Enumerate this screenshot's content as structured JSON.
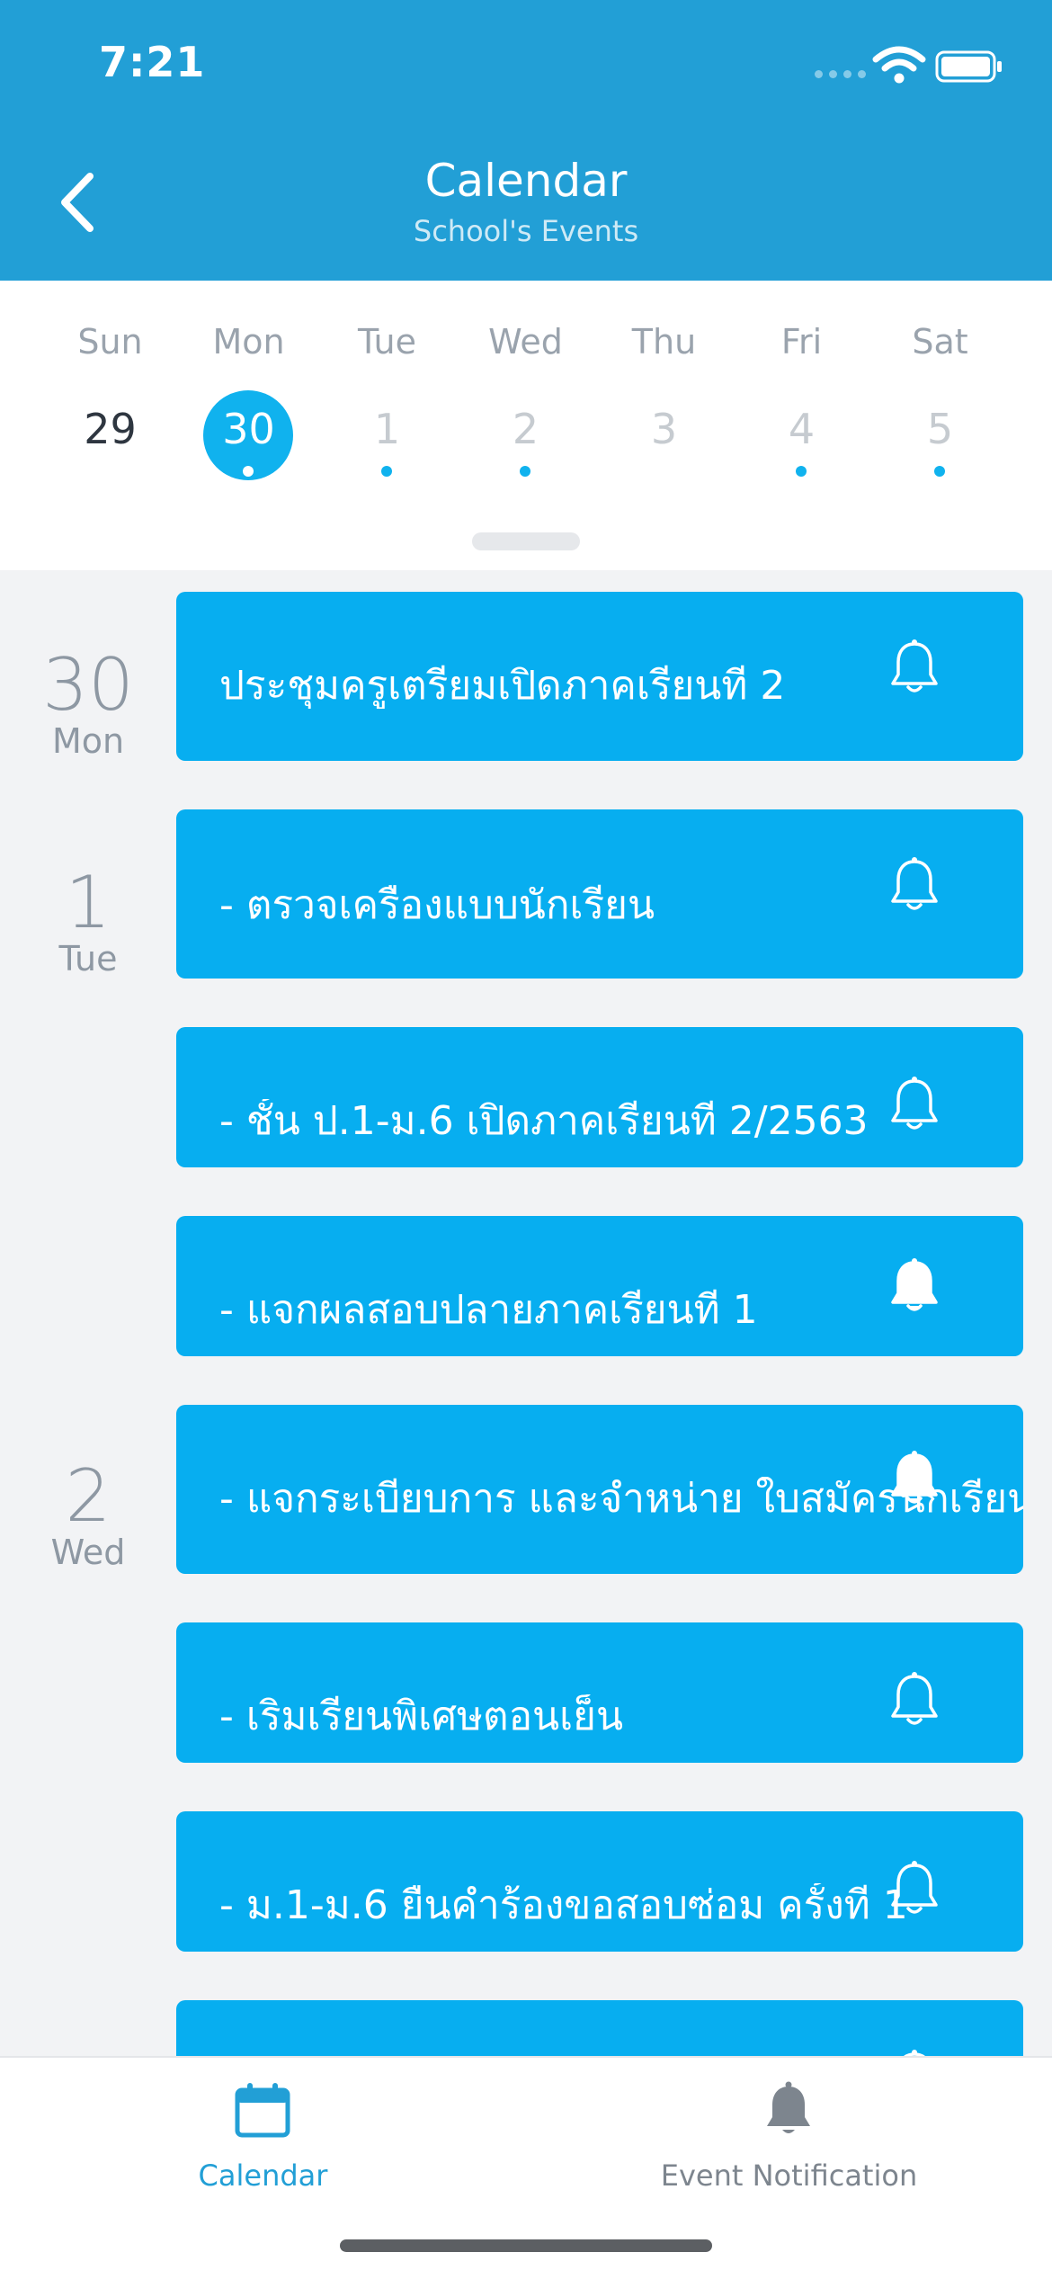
{
  "status_bar": {
    "time": "7:21"
  },
  "header": {
    "title": "Calendar",
    "subtitle": "School's Events"
  },
  "week": [
    {
      "weekday": "Sun",
      "day": "29"
    },
    {
      "weekday": "Mon",
      "day": "30"
    },
    {
      "weekday": "Tue",
      "day": "1"
    },
    {
      "weekday": "Wed",
      "day": "2"
    },
    {
      "weekday": "Thu",
      "day": "3"
    },
    {
      "weekday": "Fri",
      "day": "4"
    },
    {
      "weekday": "Sat",
      "day": "5"
    }
  ],
  "date_groups": [
    {
      "day": "30",
      "weekday": "Mon"
    },
    {
      "day": "1",
      "weekday": "Tue"
    },
    {
      "day": "2",
      "weekday": "Wed"
    }
  ],
  "events": [
    {
      "title": "ประชุมครูเตรียมเปิดภาคเรียนที่ 2"
    },
    {
      "title": "- ตรวจเครื่องแบบนักเรียน"
    },
    {
      "title": "- ชั้น ป.1-ม.6 เปิดภาคเรียนที่ 2/2563"
    },
    {
      "title": "- แจกผลสอบปลายภาคเรียนที่ 1"
    },
    {
      "title": "- แจกระเบียบการ และจำหน่าย ใบสมัครนักเรียน"
    },
    {
      "title": "- เริ่มเรียนพิเศษตอนเย็น"
    },
    {
      "title": "- ม.1-ม.6 ยื่นคำร้องขอสอบซ่อม ครั้งที่ 1"
    }
  ],
  "tabs": [
    {
      "label": "Calendar"
    },
    {
      "label": "Event Notification"
    }
  ],
  "colors": {
    "header": "#229fd6",
    "accent": "#10b2ee",
    "card": "#07aef0",
    "tab_active": "#229fd6",
    "tab_inactive": "#7d858e"
  }
}
